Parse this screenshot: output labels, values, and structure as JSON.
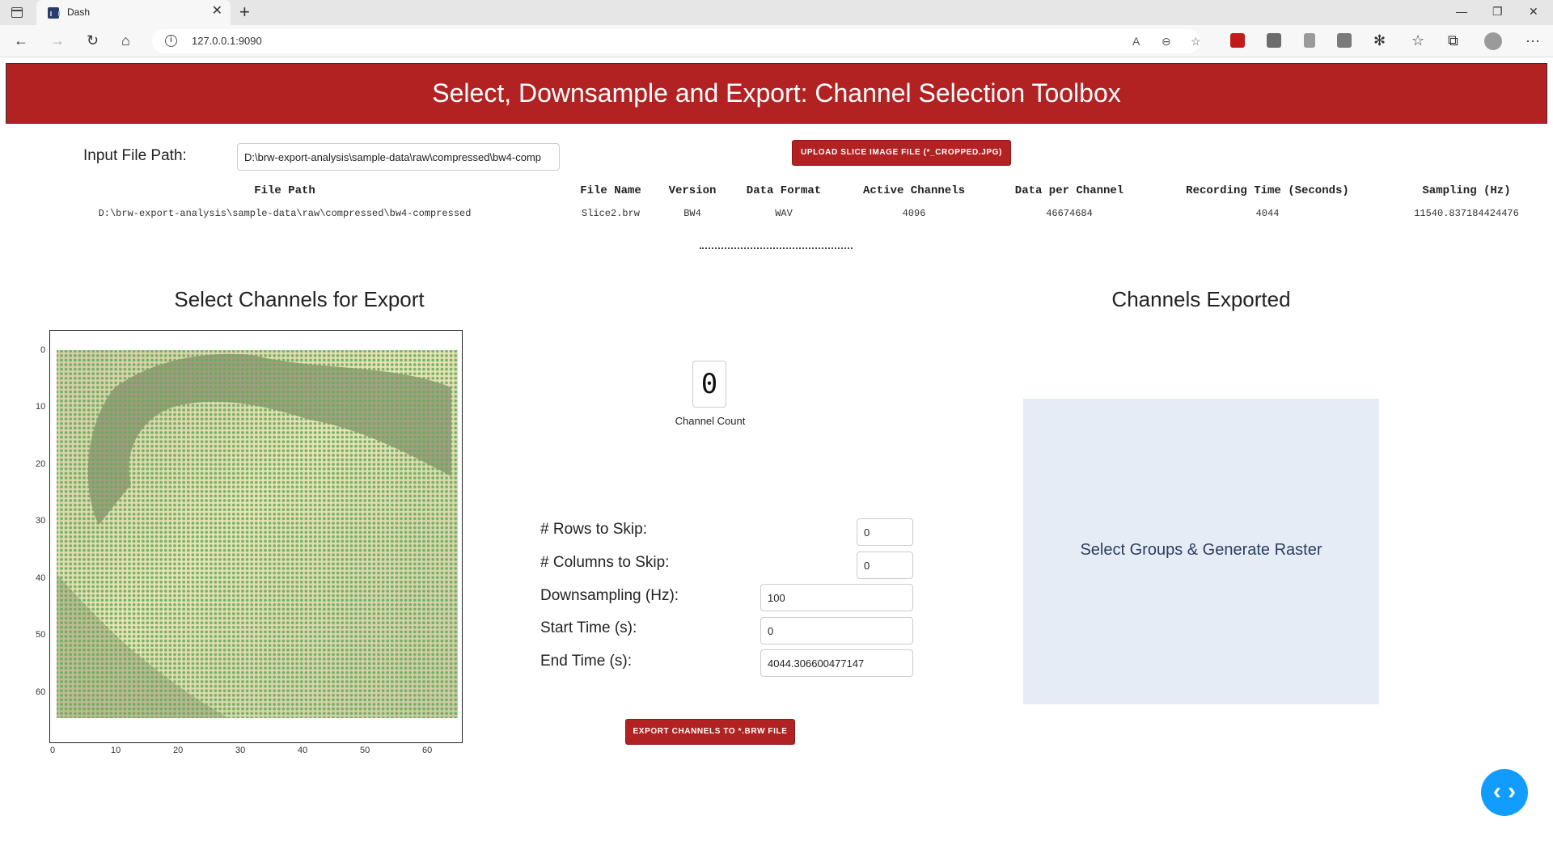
{
  "browser": {
    "tab_title": "Dash",
    "url": "127.0.0.1:9090"
  },
  "header": {
    "title": "Select, Downsample and Export: Channel Selection Toolbox"
  },
  "input": {
    "label": "Input File Path:",
    "value": "D:\\brw-export-analysis\\sample-data\\raw\\compressed\\bw4-comp"
  },
  "upload_button": "UPLOAD SLICE IMAGE FILE (*_CROPPED.JPG)",
  "info_table": {
    "headers": [
      "File Path",
      "File Name",
      "Version",
      "Data Format",
      "Active Channels",
      "Data per Channel",
      "Recording Time (Seconds)",
      "Sampling (Hz)"
    ],
    "values": [
      "D:\\brw-export-analysis\\sample-data\\raw\\compressed\\bw4-compressed",
      "Slice2.brw",
      "BW4",
      "WAV",
      "4096",
      "46674684",
      "4044",
      "11540.837184424476"
    ]
  },
  "left_panel": {
    "title": "Select Channels for Export",
    "y_ticks": [
      "0",
      "10",
      "20",
      "30",
      "40",
      "50",
      "60"
    ],
    "x_ticks": [
      "0",
      "10",
      "20",
      "30",
      "40",
      "50",
      "60"
    ]
  },
  "channel_count": {
    "value": "0",
    "label": "Channel Count"
  },
  "form": {
    "rows_label": "# Rows to Skip:",
    "rows_value": "0",
    "cols_label": "# Columns to Skip:",
    "cols_value": "0",
    "ds_label": "Downsampling (Hz):",
    "ds_value": "100",
    "start_label": "Start Time (s):",
    "start_value": "0",
    "end_label": "End Time (s):",
    "end_value": "4044.306600477147"
  },
  "export_button": "EXPORT CHANNELS TO *.BRW FILE",
  "right_panel": {
    "title": "Channels Exported",
    "placeholder": "Select Groups & Generate Raster"
  },
  "colors": {
    "accent": "#b22222",
    "dot": "#4caf50",
    "raster_bg": "#e5ecf6",
    "fab": "#119dff"
  }
}
